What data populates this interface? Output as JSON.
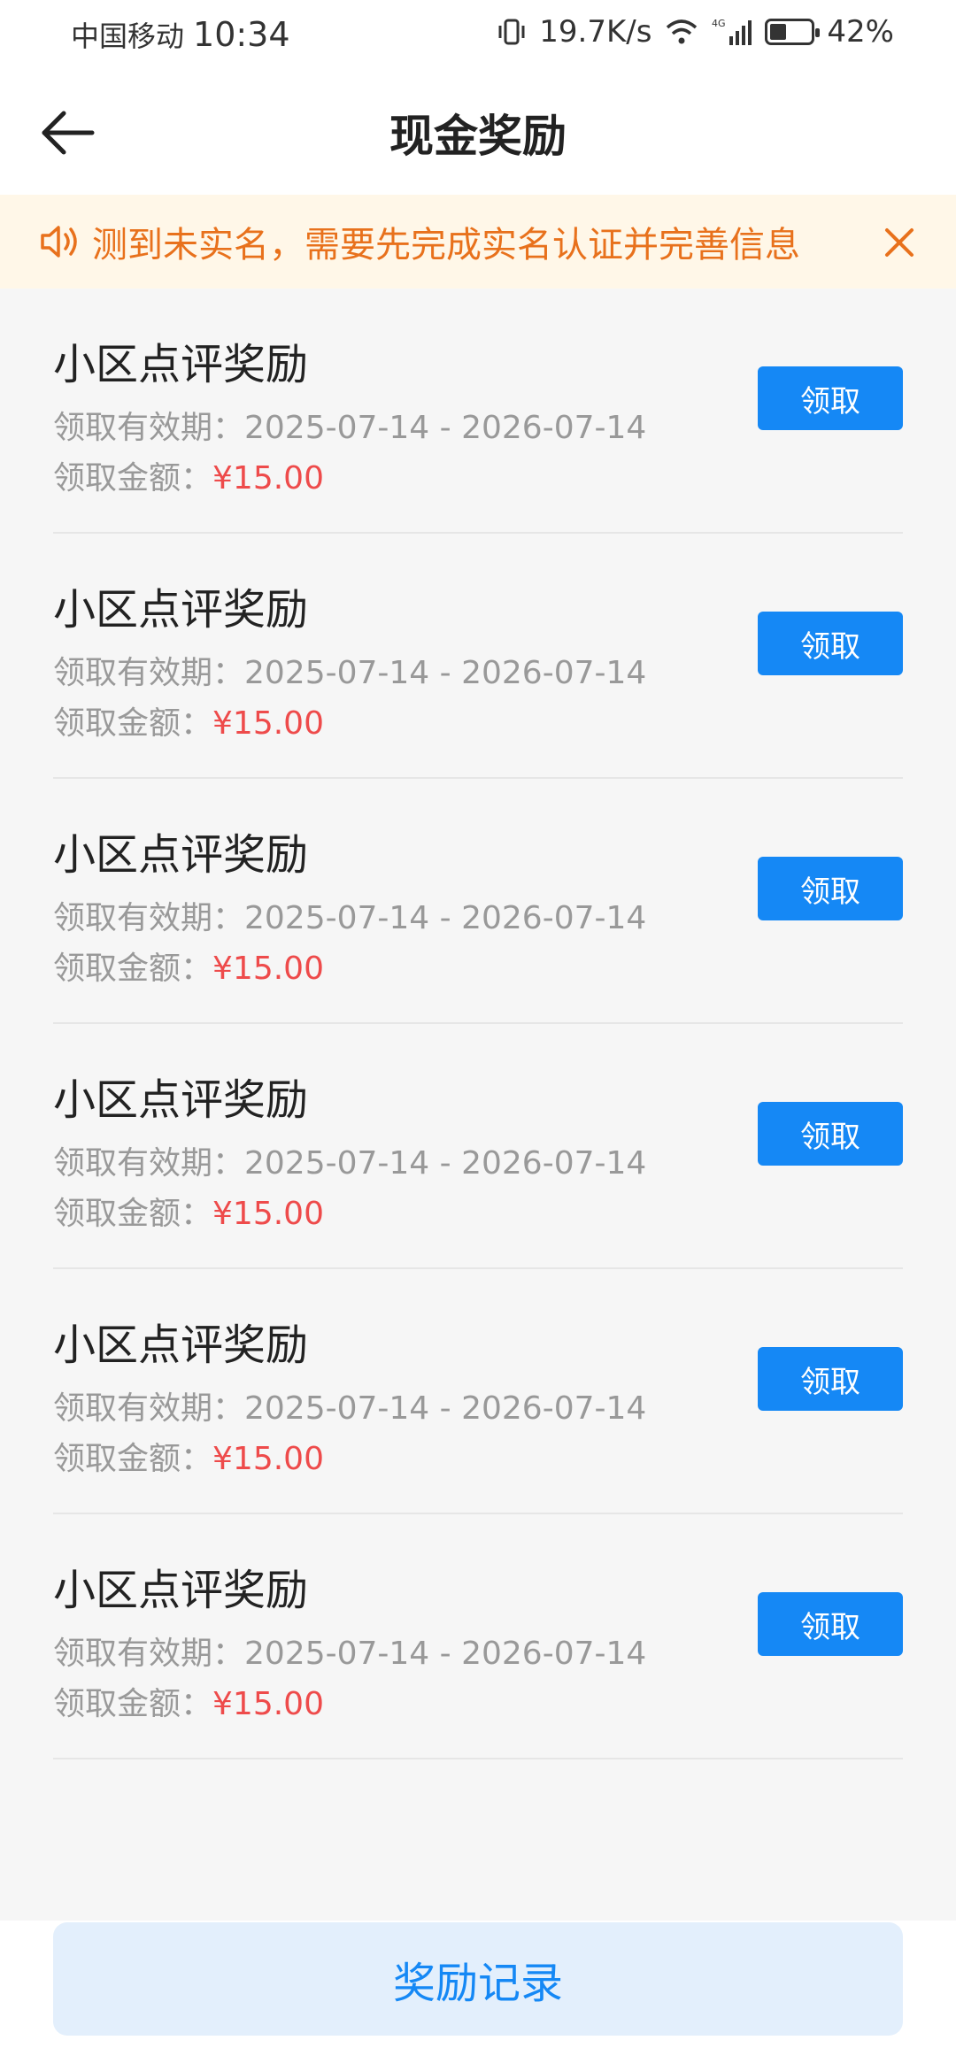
{
  "status_bar": {
    "carrier": "中国移动",
    "time": "10:34",
    "net_speed": "19.7K/s",
    "network": "4G",
    "battery_text": "42%",
    "battery_level": 0.42
  },
  "header": {
    "title": "现金奖励",
    "back_icon": "arrow-left-icon"
  },
  "notice": {
    "text": "测到未实名，需要先完成实名认证并完善信息",
    "color": "#e8711c",
    "icon": "speaker-icon",
    "close_icon": "close-icon"
  },
  "rewards": [
    {
      "title": "小区点评奖励",
      "validity": "领取有效期：2025-07-14 - 2026-07-14",
      "amount_label": "领取金额：",
      "amount": "¥15.00",
      "button": "领取"
    },
    {
      "title": "小区点评奖励",
      "validity": "领取有效期：2025-07-14 - 2026-07-14",
      "amount_label": "领取金额：",
      "amount": "¥15.00",
      "button": "领取"
    },
    {
      "title": "小区点评奖励",
      "validity": "领取有效期：2025-07-14 - 2026-07-14",
      "amount_label": "领取金额：",
      "amount": "¥15.00",
      "button": "领取"
    },
    {
      "title": "小区点评奖励",
      "validity": "领取有效期：2025-07-14 - 2026-07-14",
      "amount_label": "领取金额：",
      "amount": "¥15.00",
      "button": "领取"
    },
    {
      "title": "小区点评奖励",
      "validity": "领取有效期：2025-07-14 - 2026-07-14",
      "amount_label": "领取金额：",
      "amount": "¥15.00",
      "button": "领取"
    },
    {
      "title": "小区点评奖励",
      "validity": "领取有效期：2025-07-14 - 2026-07-14",
      "amount_label": "领取金额：",
      "amount": "¥15.00",
      "button": "领取"
    }
  ],
  "footer": {
    "records_label": "奖励记录"
  },
  "colors": {
    "accent": "#1588f5",
    "amount": "#ee4b4b",
    "notice_bg": "#fff7e8"
  }
}
